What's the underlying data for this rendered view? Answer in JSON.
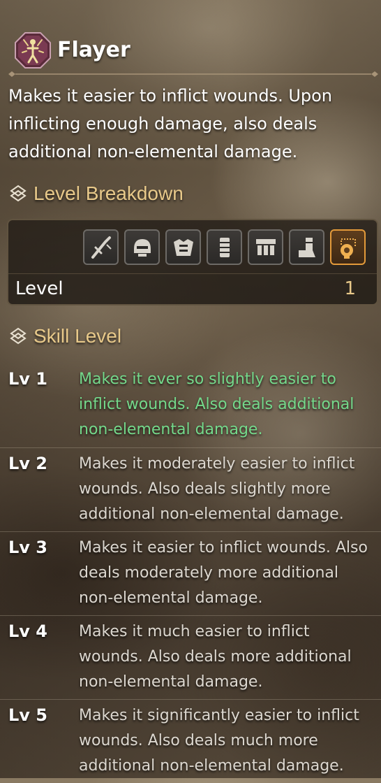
{
  "skill": {
    "name": "Flayer",
    "icon": "flayer-skill-icon",
    "description": "Makes it easier to inflict wounds. Upon inflicting enough damage, also deals additional non-elemental damage."
  },
  "breakdown": {
    "heading": "Level Breakdown",
    "heading_icon": "skill-diamond-icon",
    "equipment_slots": [
      {
        "icon": "weapon-icon",
        "active": false
      },
      {
        "icon": "helm-icon",
        "active": false
      },
      {
        "icon": "chest-armor-icon",
        "active": false
      },
      {
        "icon": "arm-armor-icon",
        "active": false
      },
      {
        "icon": "waist-armor-icon",
        "active": false
      },
      {
        "icon": "leg-armor-icon",
        "active": false
      },
      {
        "icon": "talisman-icon",
        "active": true
      }
    ],
    "level_label": "Level",
    "level_value": "1"
  },
  "skill_levels": {
    "heading": "Skill Level",
    "heading_icon": "skill-diamond-icon",
    "current_level": 1,
    "levels": [
      {
        "label": "Lv 1",
        "desc": "Makes it ever so slightly easier to inflict wounds. Also deals additional non-elemental damage."
      },
      {
        "label": "Lv 2",
        "desc": "Makes it moderately easier to inflict wounds. Also deals slightly more additional non-elemental damage."
      },
      {
        "label": "Lv 3",
        "desc": "Makes it easier to inflict wounds. Also deals moderately more additional non-elemental damage."
      },
      {
        "label": "Lv 4",
        "desc": "Makes it much easier to inflict wounds. Also deals more additional non-elemental damage."
      },
      {
        "label": "Lv 5",
        "desc": "Makes it significantly easier to inflict wounds. Also deals much more additional non-elemental damage."
      }
    ]
  },
  "colors": {
    "accent_gold": "#e8c98a",
    "current_level_green": "#74d98b",
    "active_slot_orange": "#e39a3a"
  }
}
